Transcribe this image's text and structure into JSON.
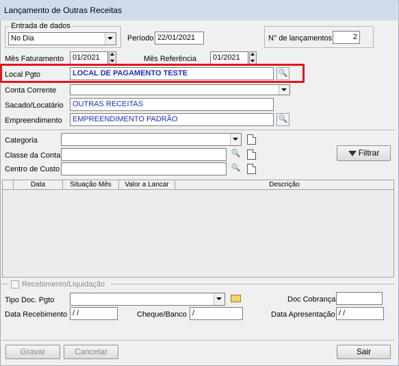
{
  "window": {
    "title": "Lançamento de Outras Receitas"
  },
  "entrada": {
    "group_label": "Entrada de dados",
    "mode_value": "No Dia",
    "periodo_label": "Período",
    "periodo_value": "22/01/2021",
    "num_lanc_label": "N° de lançamentos",
    "num_lanc_value": "2"
  },
  "mes_faturamento": {
    "label": "Mês Faturamento",
    "value": "01/2021"
  },
  "mes_referencia": {
    "label": "Mês Referência",
    "value": "01/2021"
  },
  "local_pgto": {
    "label": "Local Pgto",
    "value": "LOCAL DE PAGAMENTO TESTE"
  },
  "conta_corrente": {
    "label": "Conta Corrente",
    "value": ""
  },
  "sacado": {
    "label": "Sacado/Locatário",
    "value": "OUTRAS RECEITAS"
  },
  "empreendimento": {
    "label": "Empreendimento",
    "value": "EMPREENDIMENTO PADRÃO"
  },
  "filters": {
    "categoria_label": "Categoria",
    "classe_label": "Classe da Conta",
    "centro_label": "Centro de Custo",
    "filtrar_label": "Filtrar"
  },
  "grid": {
    "columns": [
      "Data",
      "Situação Mês",
      "Valor a Lancar",
      "Descrição"
    ]
  },
  "recebimento": {
    "group_label": "Recebimento/Liquidação",
    "tipo_doc_label": "Tipo Doc. Pgto",
    "doc_cobranca_label": "Doc Cobrança",
    "data_recebimento_label": "Data Recebimento",
    "data_recebimento_value": " /  /",
    "cheque_label": "Cheque/Banco",
    "cheque_value": "/",
    "data_apresentacao_label": "Data Apresentação",
    "data_apresentacao_value": " /  /"
  },
  "footer": {
    "gravar": "Gravar",
    "cancelar": "Cancelar",
    "sair": "Sair"
  },
  "colors": {
    "highlight_box": "#e0161b",
    "value_text": "#1a2fb8",
    "title_bar": "#cfdcec"
  },
  "icons": [
    "binoculars-icon",
    "document-icon",
    "folder-icon",
    "funnel-icon"
  ]
}
